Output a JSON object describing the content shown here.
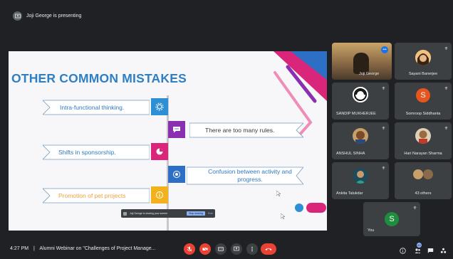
{
  "presenting": {
    "text": "Joji George is presenting"
  },
  "slide": {
    "title": "OTHER COMMON MISTAKES",
    "items": [
      {
        "text": "Intra-functional thinking."
      },
      {
        "text": "There are too many rules."
      },
      {
        "text": "Shifts in sponsorship."
      },
      {
        "text": "Confusion between activity and progress."
      },
      {
        "text": "Promotion of pet projects"
      }
    ],
    "colors": {
      "title": "#2e7fc4",
      "badge1": "#2d8fd5",
      "badge2": "#8a2fb0",
      "badge3": "#d9267a",
      "badge4": "#2d6fc4",
      "badge5": "#f2b21c"
    }
  },
  "share_bar": {
    "message": "Joji George is sharing your screen",
    "stop_label": "Stop sharing",
    "hide_label": "Hide"
  },
  "participants": [
    {
      "name": "Joji George"
    },
    {
      "name": "Sayani Banerjee"
    },
    {
      "name": "SANDIP MUKHERJEE"
    },
    {
      "name": "Somroop Siddhanta",
      "initial": "S",
      "color": "#e8541e"
    },
    {
      "name": "ANSHUL SINHA"
    },
    {
      "name": "Hari Narayan Sharma"
    },
    {
      "name": "Ankita Talukdar"
    },
    {
      "name": "43 others"
    },
    {
      "name": "You",
      "initial": "S",
      "color": "#1e8e3e"
    }
  ],
  "controls": {
    "time": "4:27 PM",
    "separator": "|",
    "meeting_title": "Alumni Webinar on \"Challenges of Project Manage...",
    "chat_badge": "60",
    "mic_color": "#ea4335",
    "end_call_color": "#ea4335"
  }
}
